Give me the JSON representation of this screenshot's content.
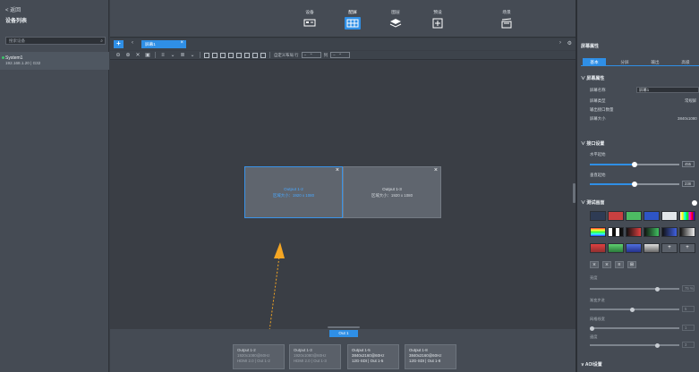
{
  "sidebar": {
    "back": "< 返回",
    "title": "设备列表",
    "search_placeholder": "搜索设备",
    "device": {
      "name": "System1",
      "ip": "192.168.1.20 | G32"
    }
  },
  "toolbar": {
    "items": [
      {
        "label": "设备",
        "icon": "device-icon"
      },
      {
        "label": "配屏",
        "icon": "screen-config-icon"
      },
      {
        "label": "图层",
        "icon": "layers-icon"
      },
      {
        "label": "预设",
        "icon": "preset-add-icon"
      },
      {
        "label": "场景",
        "icon": "scene-icon"
      }
    ],
    "active": "配屏"
  },
  "tabs": {
    "current": "屏幕1"
  },
  "canvas_toolbar": {
    "custom_label": "自定义布局 行",
    "col_label": "列"
  },
  "windows": [
    {
      "title": "Output 1-2",
      "resolution": "区域大小：1920 x 1080",
      "selected": true
    },
    {
      "title": "Output 1-3",
      "resolution": "区域大小：1920 x 1080",
      "selected": false
    }
  ],
  "output_tab": "Out 1",
  "outputs": [
    {
      "name": "Output 1-2",
      "res": "1920x1080@60Hz",
      "port": "HDMI 2.0 | Out 1-2",
      "dim": true
    },
    {
      "name": "Output 1-3",
      "res": "1920x1080@60Hz",
      "port": "HDMI 2.0 | Out 1-3",
      "dim": true
    },
    {
      "name": "Output 1-5",
      "res": "3840x2160@60Hz",
      "port": "12G-SDI | Out 1-5",
      "dim": false
    },
    {
      "name": "Output 1-8",
      "res": "3840x2160@60Hz",
      "port": "12G-SDI | Out 1-8",
      "dim": false
    }
  ],
  "right_panel": {
    "header": "屏幕属性",
    "tabs": [
      "基本",
      "分屏",
      "输出",
      "高级"
    ],
    "screen_section": "屏幕属性",
    "rows": [
      {
        "k": "屏幕名称",
        "v": "屏幕1"
      },
      {
        "k": "屏幕类型",
        "v": "常规屏"
      },
      {
        "k": "输出接口数量",
        "v": ""
      },
      {
        "k": "屏幕大小",
        "v": "3840x1080"
      }
    ],
    "port_section": "接口设置",
    "h_label": "水平起始",
    "h_value": "455",
    "v_label": "垂直起始",
    "v_value": "238",
    "test_section": "测试画面",
    "brightness": "亮度",
    "brightness_value": "75 %",
    "gradient": "渐变步进",
    "gradient_value": "5",
    "gridw": "网格线宽",
    "gridw_value": "1",
    "speed": "速度",
    "speed_value": "3",
    "aoi_section": "AOI设置"
  }
}
